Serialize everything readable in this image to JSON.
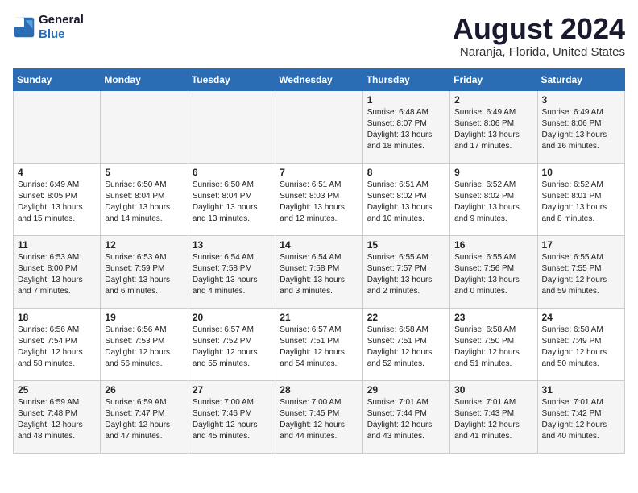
{
  "header": {
    "logo_line1": "General",
    "logo_line2": "Blue",
    "month_title": "August 2024",
    "location": "Naranja, Florida, United States"
  },
  "weekdays": [
    "Sunday",
    "Monday",
    "Tuesday",
    "Wednesday",
    "Thursday",
    "Friday",
    "Saturday"
  ],
  "weeks": [
    [
      {
        "day": "",
        "info": ""
      },
      {
        "day": "",
        "info": ""
      },
      {
        "day": "",
        "info": ""
      },
      {
        "day": "",
        "info": ""
      },
      {
        "day": "1",
        "info": "Sunrise: 6:48 AM\nSunset: 8:07 PM\nDaylight: 13 hours\nand 18 minutes."
      },
      {
        "day": "2",
        "info": "Sunrise: 6:49 AM\nSunset: 8:06 PM\nDaylight: 13 hours\nand 17 minutes."
      },
      {
        "day": "3",
        "info": "Sunrise: 6:49 AM\nSunset: 8:06 PM\nDaylight: 13 hours\nand 16 minutes."
      }
    ],
    [
      {
        "day": "4",
        "info": "Sunrise: 6:49 AM\nSunset: 8:05 PM\nDaylight: 13 hours\nand 15 minutes."
      },
      {
        "day": "5",
        "info": "Sunrise: 6:50 AM\nSunset: 8:04 PM\nDaylight: 13 hours\nand 14 minutes."
      },
      {
        "day": "6",
        "info": "Sunrise: 6:50 AM\nSunset: 8:04 PM\nDaylight: 13 hours\nand 13 minutes."
      },
      {
        "day": "7",
        "info": "Sunrise: 6:51 AM\nSunset: 8:03 PM\nDaylight: 13 hours\nand 12 minutes."
      },
      {
        "day": "8",
        "info": "Sunrise: 6:51 AM\nSunset: 8:02 PM\nDaylight: 13 hours\nand 10 minutes."
      },
      {
        "day": "9",
        "info": "Sunrise: 6:52 AM\nSunset: 8:02 PM\nDaylight: 13 hours\nand 9 minutes."
      },
      {
        "day": "10",
        "info": "Sunrise: 6:52 AM\nSunset: 8:01 PM\nDaylight: 13 hours\nand 8 minutes."
      }
    ],
    [
      {
        "day": "11",
        "info": "Sunrise: 6:53 AM\nSunset: 8:00 PM\nDaylight: 13 hours\nand 7 minutes."
      },
      {
        "day": "12",
        "info": "Sunrise: 6:53 AM\nSunset: 7:59 PM\nDaylight: 13 hours\nand 6 minutes."
      },
      {
        "day": "13",
        "info": "Sunrise: 6:54 AM\nSunset: 7:58 PM\nDaylight: 13 hours\nand 4 minutes."
      },
      {
        "day": "14",
        "info": "Sunrise: 6:54 AM\nSunset: 7:58 PM\nDaylight: 13 hours\nand 3 minutes."
      },
      {
        "day": "15",
        "info": "Sunrise: 6:55 AM\nSunset: 7:57 PM\nDaylight: 13 hours\nand 2 minutes."
      },
      {
        "day": "16",
        "info": "Sunrise: 6:55 AM\nSunset: 7:56 PM\nDaylight: 13 hours\nand 0 minutes."
      },
      {
        "day": "17",
        "info": "Sunrise: 6:55 AM\nSunset: 7:55 PM\nDaylight: 12 hours\nand 59 minutes."
      }
    ],
    [
      {
        "day": "18",
        "info": "Sunrise: 6:56 AM\nSunset: 7:54 PM\nDaylight: 12 hours\nand 58 minutes."
      },
      {
        "day": "19",
        "info": "Sunrise: 6:56 AM\nSunset: 7:53 PM\nDaylight: 12 hours\nand 56 minutes."
      },
      {
        "day": "20",
        "info": "Sunrise: 6:57 AM\nSunset: 7:52 PM\nDaylight: 12 hours\nand 55 minutes."
      },
      {
        "day": "21",
        "info": "Sunrise: 6:57 AM\nSunset: 7:51 PM\nDaylight: 12 hours\nand 54 minutes."
      },
      {
        "day": "22",
        "info": "Sunrise: 6:58 AM\nSunset: 7:51 PM\nDaylight: 12 hours\nand 52 minutes."
      },
      {
        "day": "23",
        "info": "Sunrise: 6:58 AM\nSunset: 7:50 PM\nDaylight: 12 hours\nand 51 minutes."
      },
      {
        "day": "24",
        "info": "Sunrise: 6:58 AM\nSunset: 7:49 PM\nDaylight: 12 hours\nand 50 minutes."
      }
    ],
    [
      {
        "day": "25",
        "info": "Sunrise: 6:59 AM\nSunset: 7:48 PM\nDaylight: 12 hours\nand 48 minutes."
      },
      {
        "day": "26",
        "info": "Sunrise: 6:59 AM\nSunset: 7:47 PM\nDaylight: 12 hours\nand 47 minutes."
      },
      {
        "day": "27",
        "info": "Sunrise: 7:00 AM\nSunset: 7:46 PM\nDaylight: 12 hours\nand 45 minutes."
      },
      {
        "day": "28",
        "info": "Sunrise: 7:00 AM\nSunset: 7:45 PM\nDaylight: 12 hours\nand 44 minutes."
      },
      {
        "day": "29",
        "info": "Sunrise: 7:01 AM\nSunset: 7:44 PM\nDaylight: 12 hours\nand 43 minutes."
      },
      {
        "day": "30",
        "info": "Sunrise: 7:01 AM\nSunset: 7:43 PM\nDaylight: 12 hours\nand 41 minutes."
      },
      {
        "day": "31",
        "info": "Sunrise: 7:01 AM\nSunset: 7:42 PM\nDaylight: 12 hours\nand 40 minutes."
      }
    ]
  ]
}
